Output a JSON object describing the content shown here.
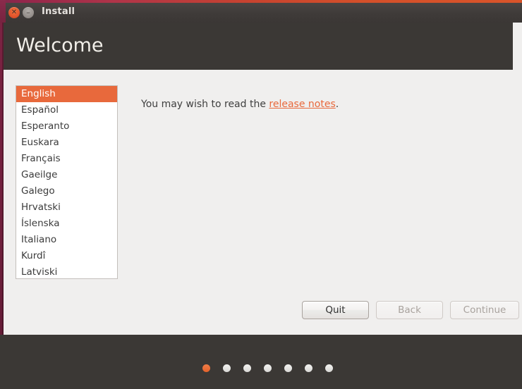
{
  "window": {
    "title": "Install",
    "close_icon": "close-icon",
    "close_glyph": "✕",
    "minimize_icon": "minimize-icon",
    "minimize_glyph": "–"
  },
  "header": {
    "title": "Welcome"
  },
  "language_list": {
    "items": [
      {
        "label": "English",
        "selected": true
      },
      {
        "label": "Español",
        "selected": false
      },
      {
        "label": "Esperanto",
        "selected": false
      },
      {
        "label": "Euskara",
        "selected": false
      },
      {
        "label": "Français",
        "selected": false
      },
      {
        "label": "Gaeilge",
        "selected": false
      },
      {
        "label": "Galego",
        "selected": false
      },
      {
        "label": "Hrvatski",
        "selected": false
      },
      {
        "label": "Íslenska",
        "selected": false
      },
      {
        "label": "Italiano",
        "selected": false
      },
      {
        "label": "Kurdî",
        "selected": false
      },
      {
        "label": "Latviski",
        "selected": false
      }
    ]
  },
  "main": {
    "notes_prefix": "You may wish to read the ",
    "notes_link": "release notes",
    "notes_suffix": "."
  },
  "buttons": {
    "quit": "Quit",
    "back": "Back",
    "continue": "Continue"
  },
  "progress": {
    "total": 7,
    "active_index": 0
  },
  "colors": {
    "accent_orange": "#e8693c",
    "header_dark": "#3b3835",
    "body_gray": "#f0efee",
    "left_edge_purple": "#7b2342"
  }
}
